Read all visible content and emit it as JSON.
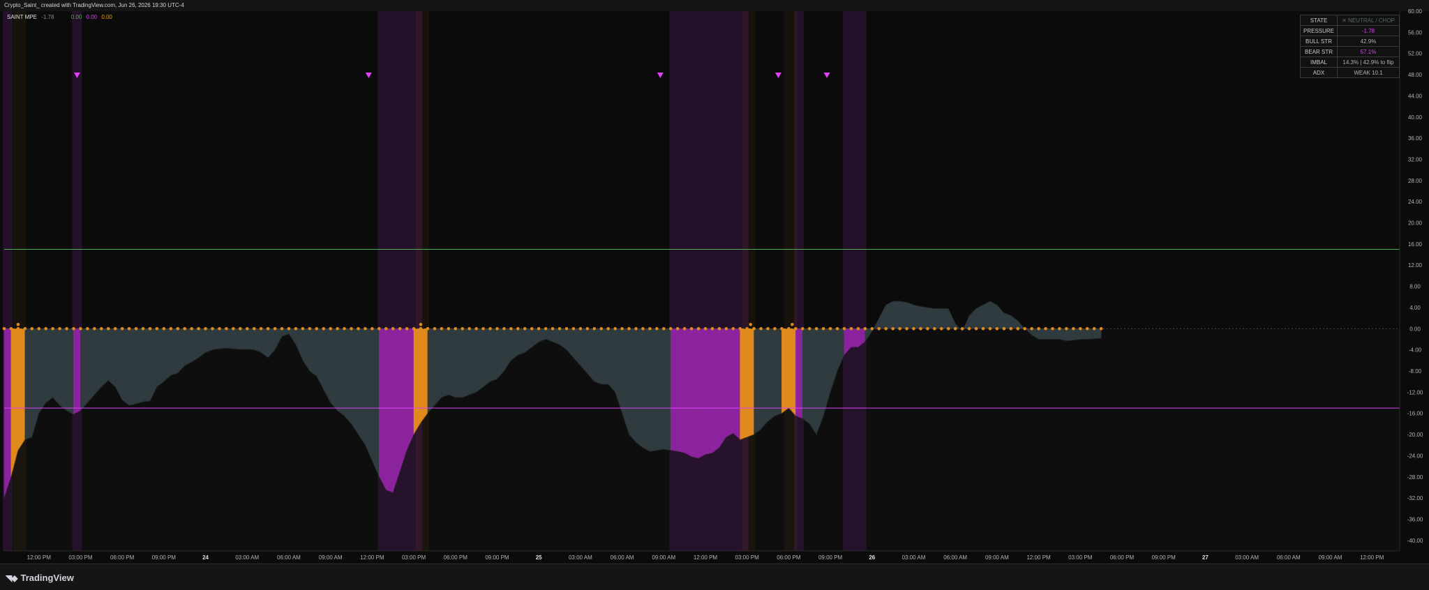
{
  "header": {
    "title": "Crypto_Saint_ created with TradingView.com, Jun 26, 2026 19:30 UTC-4"
  },
  "indicator": {
    "name": "SAINT MPE",
    "value": "-1.78",
    "v2": "0.00",
    "v3": "0.00",
    "v4": "0.00"
  },
  "brand": {
    "name": "TradingView",
    "logo": "tradingview-logo"
  },
  "status_table": [
    {
      "key": "STATE",
      "value": "✕ NEUTRAL / CHOP",
      "tone": "state"
    },
    {
      "key": "PRESSURE",
      "value": "-1.78",
      "tone": "bear"
    },
    {
      "key": "BULL STR",
      "value": "42.9%",
      "tone": "bull"
    },
    {
      "key": "BEAR STR",
      "value": "57.1%",
      "tone": "bear"
    },
    {
      "key": "IMBAL",
      "value": "14.3%  |  42.9% to flip",
      "tone": "bull"
    },
    {
      "key": "ADX",
      "value": "WEAK   10.1",
      "tone": "bull"
    }
  ],
  "colors": {
    "bear": "#9c27b0",
    "bear_marker": "#e040fb",
    "bull_fill": "#2f3b3f",
    "orange": "#e08a1e",
    "upper_line": "#4caf50",
    "lower_line": "#e040fb",
    "bg": "#0b0b0b"
  },
  "chart_data": {
    "type": "area",
    "y_ticks": [
      "60.00",
      "56.00",
      "52.00",
      "48.00",
      "44.00",
      "40.00",
      "36.00",
      "32.00",
      "28.00",
      "24.00",
      "20.00",
      "16.00",
      "12.00",
      "8.00",
      "4.00",
      "0.00",
      "-4.00",
      "-8.00",
      "-12.00",
      "-16.00",
      "-20.00",
      "-24.00",
      "-28.00",
      "-32.00",
      "-36.00",
      "-40.00"
    ],
    "ylim": [
      -42,
      60
    ],
    "x_range": [
      0,
      201
    ],
    "x_ticks": [
      {
        "x": 5,
        "label": "12:00 PM"
      },
      {
        "x": 11,
        "label": "03:00 PM"
      },
      {
        "x": 17,
        "label": "06:00 PM"
      },
      {
        "x": 23,
        "label": "09:00 PM"
      },
      {
        "x": 29,
        "label": "24"
      },
      {
        "x": 35,
        "label": "03:00 AM"
      },
      {
        "x": 41,
        "label": "06:00 AM"
      },
      {
        "x": 47,
        "label": "09:00 AM"
      },
      {
        "x": 53,
        "label": "12:00 PM"
      },
      {
        "x": 59,
        "label": "03:00 PM"
      },
      {
        "x": 65,
        "label": "06:00 PM"
      },
      {
        "x": 71,
        "label": "09:00 PM"
      },
      {
        "x": 77,
        "label": "25"
      },
      {
        "x": 83,
        "label": "03:00 AM"
      },
      {
        "x": 89,
        "label": "06:00 AM"
      },
      {
        "x": 95,
        "label": "09:00 AM"
      },
      {
        "x": 101,
        "label": "12:00 PM"
      },
      {
        "x": 107,
        "label": "03:00 PM"
      },
      {
        "x": 113,
        "label": "06:00 PM"
      },
      {
        "x": 119,
        "label": "09:00 PM"
      },
      {
        "x": 125,
        "label": "26"
      },
      {
        "x": 131,
        "label": "03:00 AM"
      },
      {
        "x": 137,
        "label": "06:00 AM"
      },
      {
        "x": 143,
        "label": "09:00 AM"
      },
      {
        "x": 149,
        "label": "12:00 PM"
      },
      {
        "x": 155,
        "label": "03:00 PM"
      },
      {
        "x": 161,
        "label": "06:00 PM"
      },
      {
        "x": 167,
        "label": "09:00 PM"
      },
      {
        "x": 173,
        "label": "27"
      },
      {
        "x": 179,
        "label": "03:00 AM"
      },
      {
        "x": 185,
        "label": "06:00 AM"
      },
      {
        "x": 191,
        "label": "09:00 AM"
      },
      {
        "x": 197,
        "label": "12:00 PM"
      }
    ],
    "upper_line": 15,
    "lower_line": -15,
    "pressure": [
      [
        0,
        -32
      ],
      [
        1,
        -28
      ],
      [
        2,
        -23
      ],
      [
        3,
        -21
      ],
      [
        4,
        -20.5
      ],
      [
        5,
        -16
      ],
      [
        6,
        -14
      ],
      [
        7,
        -13
      ],
      [
        8,
        -14.5
      ],
      [
        9,
        -15.5
      ],
      [
        10,
        -16.2
      ],
      [
        11,
        -15.5
      ],
      [
        12,
        -14
      ],
      [
        13,
        -12.5
      ],
      [
        14,
        -11
      ],
      [
        15,
        -9.8
      ],
      [
        16,
        -11
      ],
      [
        17,
        -13.5
      ],
      [
        18,
        -14.5
      ],
      [
        19,
        -14.2
      ],
      [
        20,
        -13.8
      ],
      [
        21,
        -13.7
      ],
      [
        22,
        -11
      ],
      [
        23,
        -10
      ],
      [
        24,
        -8.8
      ],
      [
        25,
        -8.4
      ],
      [
        26,
        -7
      ],
      [
        27,
        -6.3
      ],
      [
        28,
        -5.5
      ],
      [
        29,
        -4.5
      ],
      [
        30,
        -4
      ],
      [
        31,
        -3.8
      ],
      [
        32,
        -3.7
      ],
      [
        33,
        -3.8
      ],
      [
        34,
        -3.9
      ],
      [
        35,
        -3.9
      ],
      [
        36,
        -4
      ],
      [
        37,
        -4.5
      ],
      [
        38,
        -5.5
      ],
      [
        39,
        -4
      ],
      [
        40,
        -1.5
      ],
      [
        41,
        -1
      ],
      [
        42,
        -3
      ],
      [
        43,
        -6
      ],
      [
        44,
        -8
      ],
      [
        45,
        -9
      ],
      [
        46,
        -11.5
      ],
      [
        47,
        -14
      ],
      [
        48,
        -15.5
      ],
      [
        49,
        -16.5
      ],
      [
        50,
        -18
      ],
      [
        51,
        -20
      ],
      [
        52,
        -22
      ],
      [
        53,
        -25
      ],
      [
        54,
        -28
      ],
      [
        55,
        -30.5
      ],
      [
        56,
        -31
      ],
      [
        57,
        -27
      ],
      [
        58,
        -23
      ],
      [
        59,
        -20
      ],
      [
        60,
        -17.8
      ],
      [
        61,
        -16
      ],
      [
        62,
        -14.5
      ],
      [
        63,
        -13
      ],
      [
        64,
        -12.5
      ],
      [
        65,
        -13
      ],
      [
        66,
        -13
      ],
      [
        67,
        -12.5
      ],
      [
        68,
        -12
      ],
      [
        69,
        -11
      ],
      [
        70,
        -10
      ],
      [
        71,
        -9.5
      ],
      [
        72,
        -8
      ],
      [
        73,
        -6
      ],
      [
        74,
        -5
      ],
      [
        75,
        -4.5
      ],
      [
        76,
        -3.5
      ],
      [
        77,
        -2.5
      ],
      [
        78,
        -2
      ],
      [
        79,
        -2.5
      ],
      [
        80,
        -3
      ],
      [
        81,
        -4
      ],
      [
        82,
        -5.5
      ],
      [
        83,
        -7
      ],
      [
        84,
        -8.5
      ],
      [
        85,
        -10
      ],
      [
        86,
        -10.5
      ],
      [
        87,
        -10.5
      ],
      [
        88,
        -12
      ],
      [
        89,
        -16
      ],
      [
        90,
        -20
      ],
      [
        91,
        -21.5
      ],
      [
        92,
        -22.5
      ],
      [
        93,
        -23.2
      ],
      [
        94,
        -23
      ],
      [
        95,
        -22.8
      ],
      [
        96,
        -23
      ],
      [
        97,
        -23.2
      ],
      [
        98,
        -23.5
      ],
      [
        99,
        -24.2
      ],
      [
        100,
        -24.5
      ],
      [
        101,
        -23.8
      ],
      [
        102,
        -23.5
      ],
      [
        103,
        -22.5
      ],
      [
        104,
        -20.5
      ],
      [
        105,
        -19.8
      ],
      [
        106,
        -21
      ],
      [
        107,
        -20.5
      ],
      [
        108,
        -20
      ],
      [
        109,
        -19
      ],
      [
        110,
        -17.5
      ],
      [
        111,
        -16.5
      ],
      [
        112,
        -16
      ],
      [
        113,
        -15
      ],
      [
        114,
        -16.5
      ],
      [
        115,
        -17
      ],
      [
        116,
        -18
      ],
      [
        117,
        -20
      ],
      [
        118,
        -16.5
      ],
      [
        119,
        -12
      ],
      [
        120,
        -8
      ],
      [
        121,
        -5
      ],
      [
        122,
        -3.5
      ],
      [
        123,
        -3.5
      ],
      [
        124,
        -2.5
      ],
      [
        125,
        -0.5
      ],
      [
        126,
        2
      ],
      [
        127,
        4.5
      ],
      [
        128,
        5.2
      ],
      [
        129,
        5.2
      ],
      [
        130,
        5
      ],
      [
        131,
        4.5
      ],
      [
        132,
        4.2
      ],
      [
        133,
        4
      ],
      [
        134,
        3.8
      ],
      [
        135,
        3.8
      ],
      [
        136,
        3.8
      ],
      [
        137,
        1
      ],
      [
        138,
        -0.5
      ],
      [
        139,
        2.5
      ],
      [
        140,
        3.8
      ],
      [
        141,
        4.5
      ],
      [
        142,
        5.2
      ],
      [
        143,
        4.5
      ],
      [
        144,
        3
      ],
      [
        145,
        2.5
      ],
      [
        146,
        1.5
      ],
      [
        147,
        0
      ],
      [
        148,
        -1.2
      ],
      [
        149,
        -2
      ],
      [
        150,
        -2
      ],
      [
        151,
        -2
      ],
      [
        152,
        -2
      ],
      [
        153,
        -2.3
      ],
      [
        154,
        -2.2
      ],
      [
        155,
        -2
      ],
      [
        156,
        -2
      ],
      [
        157,
        -1.9
      ],
      [
        158,
        -1.8
      ]
    ],
    "bear_zones": [
      [
        0,
        1
      ],
      [
        10,
        11
      ],
      [
        54,
        60
      ],
      [
        96,
        107
      ],
      [
        114,
        115
      ],
      [
        121,
        124
      ]
    ],
    "orange_bars": [
      [
        1.5,
        3
      ],
      [
        59.5,
        61
      ],
      [
        106.5,
        108
      ],
      [
        112.5,
        114
      ]
    ],
    "sell_markers": [
      10.5,
      52.5,
      94.5,
      111.5,
      118.5
    ],
    "orange_dot_range": [
      0,
      158
    ],
    "orange_dot_highlights": [
      2,
      60,
      107.5,
      113.5
    ]
  }
}
